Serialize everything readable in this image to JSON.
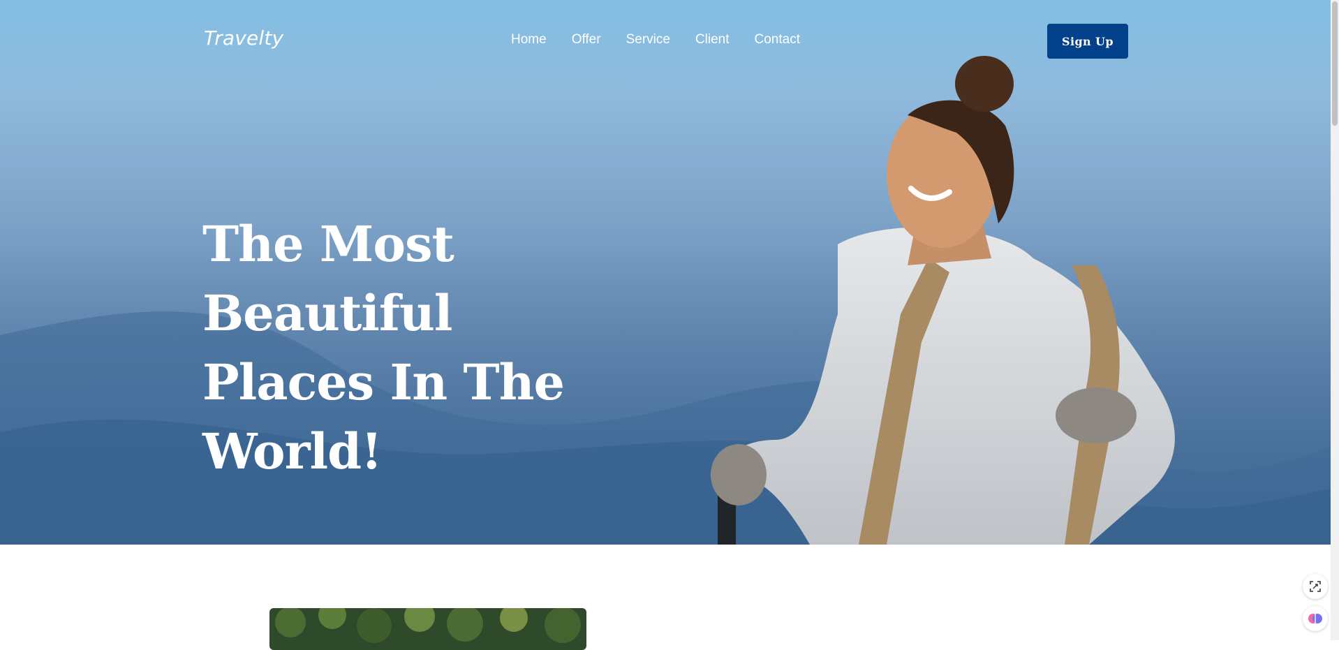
{
  "header": {
    "brand": "Travelty",
    "nav": [
      "Home",
      "Offer",
      "Service",
      "Client",
      "Contact"
    ],
    "signup_label": "Sign Up"
  },
  "hero": {
    "headline_lines": [
      "The Most Beautiful",
      "Places In The",
      "World!"
    ]
  },
  "colors": {
    "primary": "#03418a",
    "sky_top": "#83bfe3",
    "sky_bottom": "#3d6791"
  },
  "icons": [
    "capture-icon",
    "brain-icon"
  ]
}
